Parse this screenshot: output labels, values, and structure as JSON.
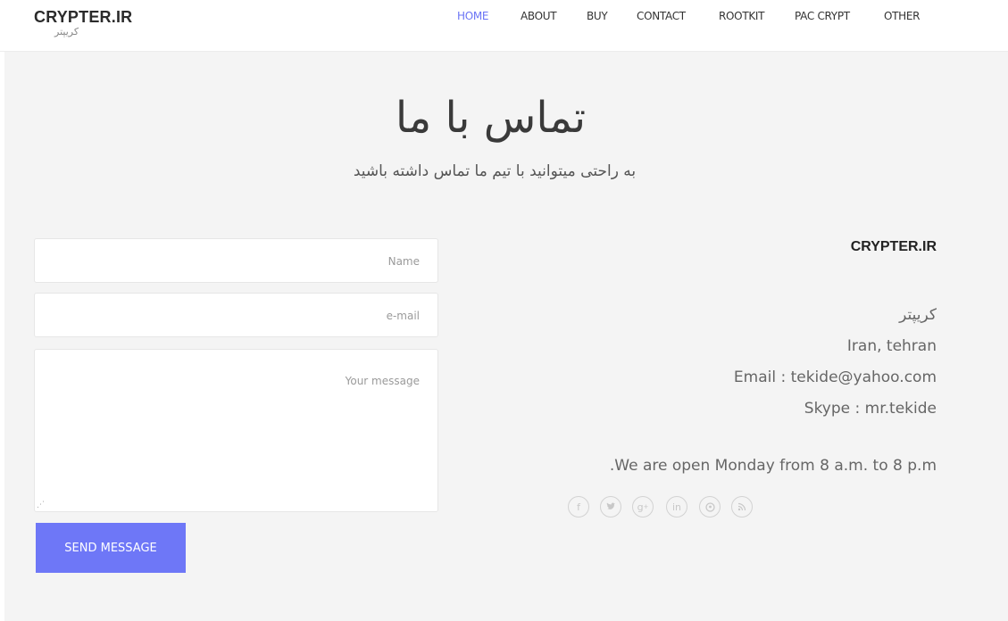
{
  "header": {
    "logo_title": "CRYPTER.IR",
    "logo_subtitle": "کریپتر",
    "nav": [
      "HOME",
      "ABOUT",
      "BUY",
      "CONTACT",
      "ROOTKIT",
      "PAC CRYPT",
      "OTHER"
    ],
    "active_nav": "HOME",
    "accent_color": "#6b74f5"
  },
  "page": {
    "heading": "تماس با ما",
    "subheading": "به راحتی میتوانید با تیم ما تماس داشته باشید"
  },
  "form": {
    "name_placeholder": "Name",
    "email_placeholder": "e-mail",
    "message_placeholder": "Your message",
    "submit_label": "SEND MESSAGE",
    "submit_color": "#6e77f7"
  },
  "contact": {
    "company": "CRYPTER.IR",
    "name_fa": "کریپتر",
    "location": "Iran, tehran",
    "email": "Email : tekide@yahoo.com",
    "skype": "Skype : mr.tekide",
    "hours": ".We are open Monday from 8 a.m. to 8 p.m"
  },
  "socials": [
    {
      "icon": "facebook-icon",
      "glyph": "f"
    },
    {
      "icon": "twitter-icon",
      "glyph": "t"
    },
    {
      "icon": "google-plus-icon",
      "glyph": "g+"
    },
    {
      "icon": "linkedin-icon",
      "glyph": "in"
    },
    {
      "icon": "pinterest-icon",
      "glyph": "p"
    },
    {
      "icon": "rss-icon",
      "glyph": "rss"
    }
  ]
}
